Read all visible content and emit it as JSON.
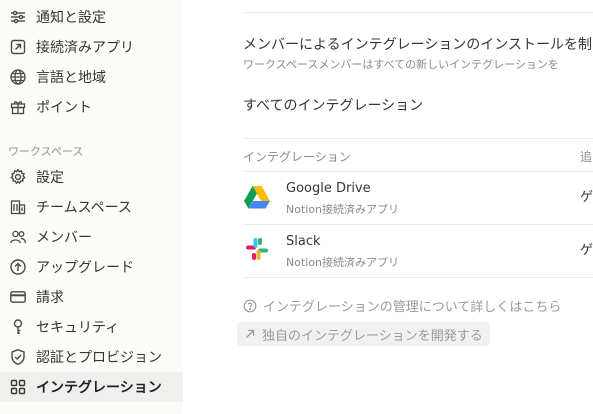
{
  "sidebar": {
    "items_top": [
      {
        "label": "通知と設定",
        "icon": "sliders-icon"
      },
      {
        "label": "接続済みアプリ",
        "icon": "external-link-icon"
      },
      {
        "label": "言語と地域",
        "icon": "globe-icon"
      },
      {
        "label": "ポイント",
        "icon": "gift-icon"
      }
    ],
    "section_label": "ワークスペース",
    "items_workspace": [
      {
        "label": "設定",
        "icon": "gear-icon"
      },
      {
        "label": "チームスペース",
        "icon": "building-icon"
      },
      {
        "label": "メンバー",
        "icon": "people-icon"
      },
      {
        "label": "アップグレード",
        "icon": "upgrade-icon"
      },
      {
        "label": "請求",
        "icon": "credit-card-icon"
      },
      {
        "label": "セキュリティ",
        "icon": "key-icon"
      },
      {
        "label": "認証とプロビジョン",
        "icon": "shield-check-icon"
      },
      {
        "label": "インテグレーション",
        "icon": "grid-icon",
        "active": true
      }
    ]
  },
  "main": {
    "restrict_title": "メンバーによるインテグレーションのインストールを制",
    "restrict_desc": "ワークスペースメンバーはすべての新しいインテグレーションを",
    "all_heading": "すべてのインテグレーション",
    "table": {
      "col_integration": "インテグレーション",
      "col_added_partial": "追",
      "rows": [
        {
          "name": "Google Drive",
          "sub": "Notion接続済みアプリ",
          "extra": "ゲ"
        },
        {
          "name": "Slack",
          "sub": "Notion接続済みアプリ",
          "extra": "ゲ"
        }
      ]
    },
    "help_link": "インテグレーションの管理について詳しくはこちら",
    "develop_button": "独自のインテグレーションを開発する"
  }
}
